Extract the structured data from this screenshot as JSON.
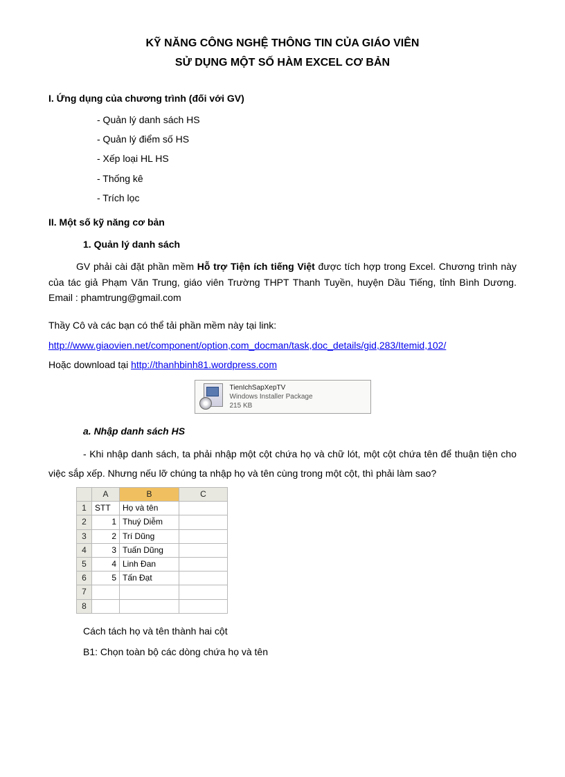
{
  "title": "KỸ NĂNG CÔNG NGHỆ THÔNG TIN CỦA GIÁO VIÊN",
  "subtitle": "SỬ DỤNG MỘT SỐ HÀM  EXCEL CƠ BẢN",
  "section1": {
    "heading": "I. Ứng dụng của chương trình (đối với GV)",
    "items": [
      "- Quản lý danh sách HS",
      "- Quản lý điểm số HS",
      "- Xếp loại HL HS",
      "- Thống kê",
      "- Trích lọc"
    ]
  },
  "section2": {
    "heading": "II. Một số kỹ năng cơ bản",
    "sub1_heading": "1. Quản lý danh sách",
    "para1_prefix": "GV phải cài đặt phần mềm ",
    "para1_bold": "Hỗ trợ Tiện ích tiếng Việt",
    "para1_suffix": " được tích hợp trong Excel. Chương trình này của tác giả Phạm Văn Trung, giáo viên Trường THPT Thanh Tuyền, huyện Dầu Tiếng, tỉnh Bình Dương. Email : phamtrung@gmail.com",
    "para2": "Thầy Cô và các bạn có thể tải phần mềm này tại link:",
    "link1": "http://www.giaovien.net/component/option,com_docman/task,doc_details/gid,283/Itemid,102/",
    "para3_prefix": "Hoặc download tại ",
    "link2": "http://thanhbinh81.wordpress.com",
    "file": {
      "name": "TienIchSapXepTV",
      "type": "Windows Installer Package",
      "size": "215 KB"
    },
    "suba_heading": "a. Nhập danh sách HS",
    "suba_para": "- Khi nhập danh sách, ta phải nhập một cột chứa họ và chữ lót, một cột chứa tên để thuận tiện cho việc sắp xếp. Nhưng nếu lỡ chúng ta nhập họ và tên cùng trong một cột, thì phải làm sao?",
    "excel": {
      "cols": [
        "A",
        "B",
        "C"
      ],
      "rows": [
        {
          "n": "1",
          "a": "STT",
          "b": "Họ và tên",
          "c": ""
        },
        {
          "n": "2",
          "a": "1",
          "b": "Thuý Diễm",
          "c": ""
        },
        {
          "n": "3",
          "a": "2",
          "b": "Trí Dũng",
          "c": ""
        },
        {
          "n": "4",
          "a": "3",
          "b": "Tuấn Dũng",
          "c": ""
        },
        {
          "n": "5",
          "a": "4",
          "b": "Linh Đan",
          "c": ""
        },
        {
          "n": "6",
          "a": "5",
          "b": "Tấn Đạt",
          "c": ""
        },
        {
          "n": "7",
          "a": "",
          "b": "",
          "c": ""
        },
        {
          "n": "8",
          "a": "",
          "b": "",
          "c": ""
        }
      ]
    },
    "step_intro": "Cách tách họ và tên thành hai cột",
    "step1": "B1: Chọn toàn bộ các dòng chứa họ và tên"
  }
}
